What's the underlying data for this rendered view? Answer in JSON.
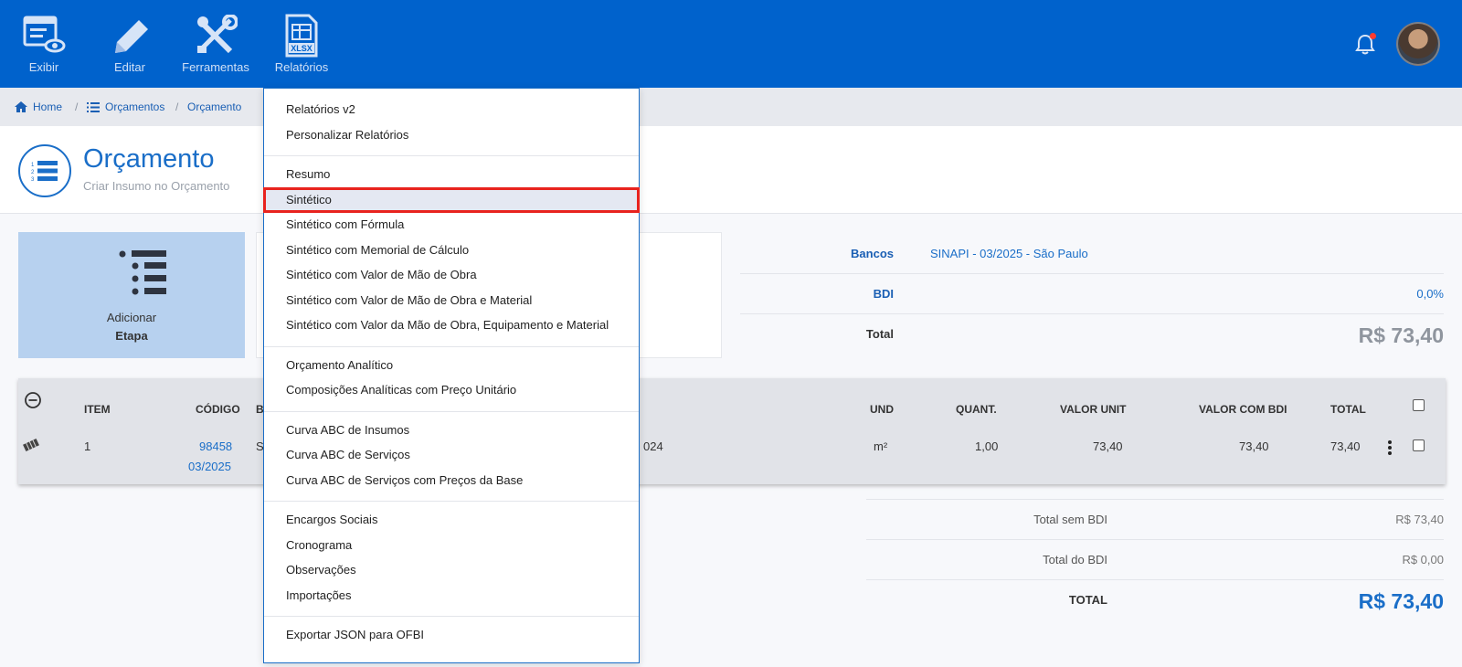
{
  "toolbar": {
    "items": [
      {
        "label": "Exibir",
        "icon": "view-list-icon"
      },
      {
        "label": "Editar",
        "icon": "pencil-icon"
      },
      {
        "label": "Ferramentas",
        "icon": "tools-icon"
      },
      {
        "label": "Relatórios",
        "icon": "xlsx-file-icon",
        "icon_text": "XLSX"
      }
    ]
  },
  "breadcrumb": [
    "Home",
    "Orçamentos",
    "Orçamento"
  ],
  "header": {
    "title": "Orçamento",
    "subtitle": "Criar Insumo no Orçamento"
  },
  "add_card": {
    "line1": "Adicionar",
    "line2": "Etapa"
  },
  "info": {
    "bancos_label": "Bancos",
    "bancos_value": "SINAPI - 03/2025 - São Paulo",
    "bdi_label": "BDI",
    "bdi_value": "0,0%",
    "total_label": "Total",
    "total_value": "R$ 73,40"
  },
  "grid": {
    "headers": {
      "item": "ITEM",
      "codigo": "CÓDIGO",
      "b": "B",
      "und": "UND",
      "quant": "QUANT.",
      "valor_unit": "VALOR UNIT",
      "valor_bdi": "VALOR COM BDI",
      "total": "TOTAL"
    },
    "rows": [
      {
        "item": "1",
        "codigo": "98458",
        "codigo_date": "03/2025",
        "b": "S",
        "desc_tail": "024",
        "und": "m²",
        "quant": "1,00",
        "valor_unit": "73,40",
        "valor_bdi": "73,40",
        "total": "73,40"
      }
    ]
  },
  "totals": {
    "sem_bdi_label": "Total sem BDI",
    "sem_bdi_value": "R$ 73,40",
    "do_bdi_label": "Total do BDI",
    "do_bdi_value": "R$ 0,00",
    "total_label": "TOTAL",
    "total_value": "R$ 73,40"
  },
  "menu": {
    "groups": [
      [
        "Relatórios v2",
        "Personalizar Relatórios"
      ],
      [
        "Resumo",
        "Sintético",
        "Sintético com Fórmula",
        "Sintético com Memorial de Cálculo",
        "Sintético com Valor de Mão de Obra",
        "Sintético com Valor de Mão de Obra e Material",
        "Sintético com Valor da Mão de Obra, Equipamento e Material"
      ],
      [
        "Orçamento Analítico",
        "Composições Analíticas com Preço Unitário"
      ],
      [
        "Curva ABC de Insumos",
        "Curva ABC de Serviços",
        "Curva ABC de Serviços com Preços da Base"
      ],
      [
        "Encargos Sociais",
        "Cronograma",
        "Observações",
        "Importações"
      ],
      [
        "Exportar JSON para OFBI"
      ]
    ],
    "selected": "Sintético"
  },
  "colors": {
    "toolbar_bg": "#0062cc",
    "accent": "#1a6ec8",
    "highlight": "#e8231e"
  }
}
